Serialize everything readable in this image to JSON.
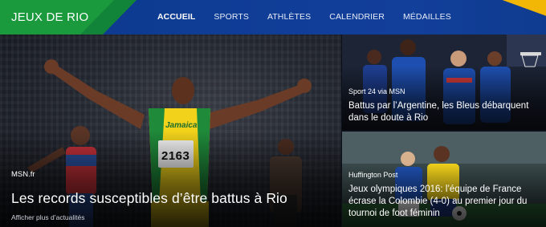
{
  "site": {
    "title": "JEUX DE RIO"
  },
  "nav": {
    "items": [
      {
        "label": "ACCUEIL",
        "active": true
      },
      {
        "label": "SPORTS",
        "active": false
      },
      {
        "label": "ATHLÈTES",
        "active": false
      },
      {
        "label": "CALENDRIER",
        "active": false
      },
      {
        "label": "MÉDAILLES",
        "active": false
      }
    ]
  },
  "hero": {
    "source": "MSN.fr",
    "title": "Les records susceptibles d’être battus à Rio",
    "more_link": "Afficher plus d’actualités",
    "bib_number": "2163",
    "jersey_text": "Jamaica"
  },
  "cards": [
    {
      "source": "Sport 24 via MSN",
      "title": "Battus par l’Argentine, les Bleus débarquent dans le doute à Rio"
    },
    {
      "source": "Huffington Post",
      "title": "Jeux olympiques 2016: l’équipe de France écrase la Colombie (4-0) au premier jour du tournoi de foot féminin"
    }
  ],
  "colors": {
    "nav_bg": "#0f3c95",
    "brand_green": "#1a9a3c",
    "accent_yellow": "#f2b705",
    "jersey_yellow": "#f2d21b",
    "france_blue": "#1e4fb0"
  }
}
